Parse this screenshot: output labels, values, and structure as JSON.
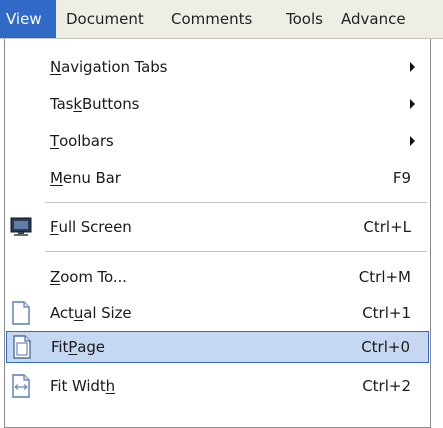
{
  "menubar": {
    "items": [
      {
        "label": "View",
        "active": true
      },
      {
        "label": "Document",
        "active": false
      },
      {
        "label": "Comments",
        "active": false
      },
      {
        "label": "Tools",
        "active": false
      },
      {
        "label": "Advance",
        "active": false
      }
    ]
  },
  "menu": {
    "items": [
      {
        "label": "Navigation Tabs",
        "mnemonic": "N",
        "shortcut": "",
        "submenu": true,
        "icon": ""
      },
      {
        "label": "Task Buttons",
        "mnemonic": "k",
        "shortcut": "",
        "submenu": true,
        "icon": ""
      },
      {
        "label": "Toolbars",
        "mnemonic": "T",
        "shortcut": "",
        "submenu": true,
        "icon": ""
      },
      {
        "label": "Menu Bar",
        "mnemonic": "M",
        "shortcut": "F9",
        "submenu": false,
        "icon": ""
      },
      {
        "label": "Full Screen",
        "mnemonic": "F",
        "shortcut": "Ctrl+L",
        "submenu": false,
        "icon": "monitor-icon"
      },
      {
        "label": "Zoom To...",
        "mnemonic": "Z",
        "shortcut": "Ctrl+M",
        "submenu": false,
        "icon": ""
      },
      {
        "label": "Actual Size",
        "mnemonic": "u",
        "shortcut": "Ctrl+1",
        "submenu": false,
        "icon": "page-icon"
      },
      {
        "label": "Fit Page",
        "mnemonic": "P",
        "shortcut": "Ctrl+0",
        "submenu": false,
        "icon": "fit-page-icon",
        "highlighted": true
      },
      {
        "label": "Fit Width",
        "mnemonic": "h",
        "shortcut": "Ctrl+2",
        "submenu": false,
        "icon": "fit-width-icon"
      }
    ]
  },
  "colors": {
    "menubar_bg": "#efeee6",
    "active_bg": "#3169c6",
    "highlight_bg": "#c6d7f2",
    "highlight_border": "#316ac5"
  }
}
